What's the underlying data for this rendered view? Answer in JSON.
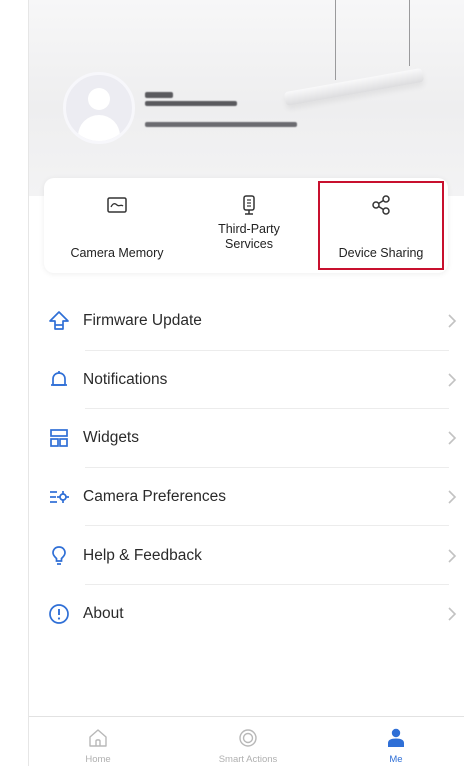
{
  "colors": {
    "accent": "#2f6fd6",
    "highlight_border": "#c8102e",
    "text": "#2a2a2a",
    "muted": "#b0b0b0"
  },
  "profile": {
    "avatar_icon": "user-avatar-icon",
    "name_redacted": true,
    "email_redacted": true
  },
  "quick_actions": [
    {
      "icon": "camera-memory-icon",
      "label_lines": [
        "Camera Memory"
      ]
    },
    {
      "icon": "third-party-services-icon",
      "label_lines": [
        "Third-Party",
        "Services"
      ]
    },
    {
      "icon": "share-icon",
      "label_lines": [
        "Device Sharing"
      ]
    }
  ],
  "menu": [
    {
      "icon": "firmware-update-icon",
      "label": "Firmware Update"
    },
    {
      "icon": "bell-icon",
      "label": "Notifications"
    },
    {
      "icon": "widgets-icon",
      "label": "Widgets"
    },
    {
      "icon": "camera-preferences-icon",
      "label": "Camera Preferences"
    },
    {
      "icon": "help-icon",
      "label": "Help & Feedback"
    },
    {
      "icon": "info-icon",
      "label": "About"
    }
  ],
  "tabbar": [
    {
      "icon": "home-icon",
      "label": "Home",
      "active": false
    },
    {
      "icon": "smart-actions-icon",
      "label": "Smart Actions",
      "active": false
    },
    {
      "icon": "me-icon",
      "label": "Me",
      "active": true
    }
  ]
}
